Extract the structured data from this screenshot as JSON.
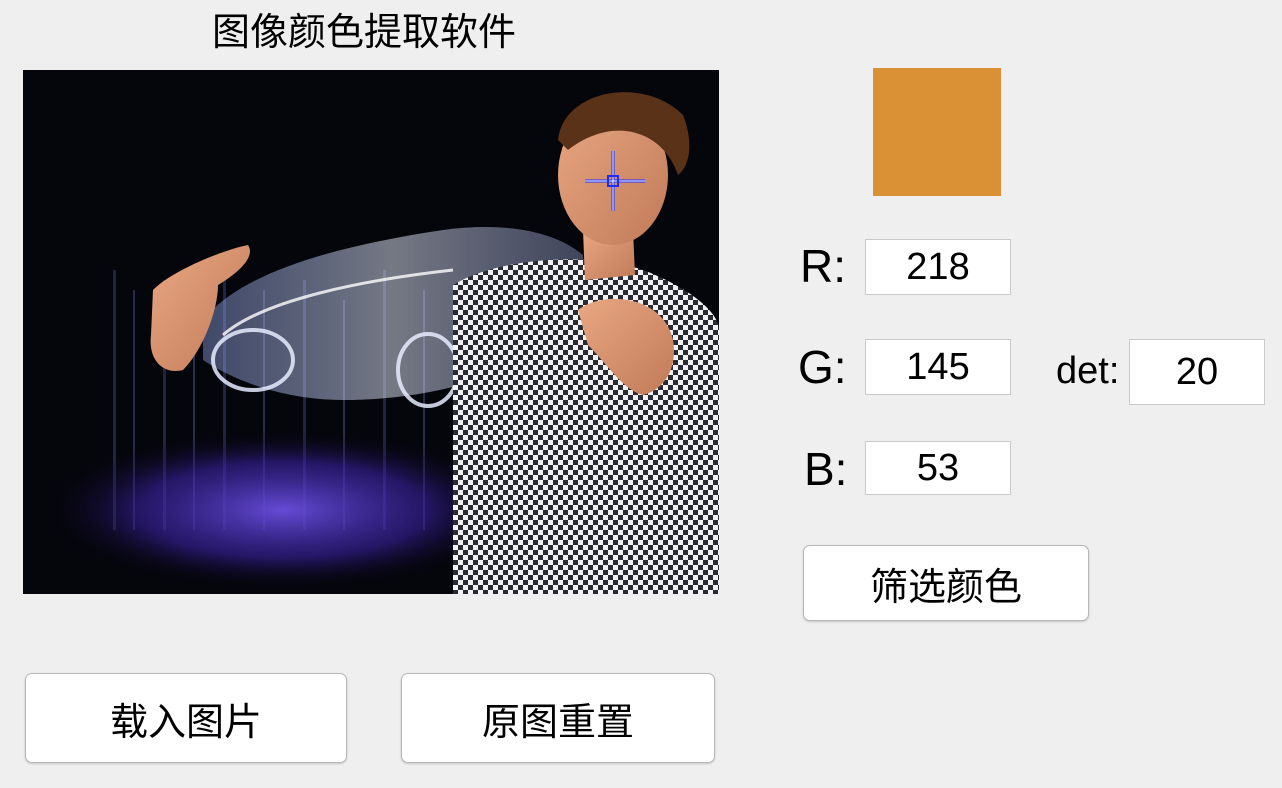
{
  "window": {
    "title": "图像颜色提取软件"
  },
  "preview": {
    "swatch_color": "#da9135"
  },
  "channels": {
    "r_label": "R:",
    "r_value": "218",
    "g_label": "G:",
    "g_value": "145",
    "b_label": "B:",
    "b_value": "53"
  },
  "tolerance": {
    "label": "det:",
    "value": "20"
  },
  "buttons": {
    "filter": "筛选颜色",
    "load": "载入图片",
    "reset": "原图重置"
  },
  "image": {
    "crosshair_color": "#1f2cff"
  }
}
